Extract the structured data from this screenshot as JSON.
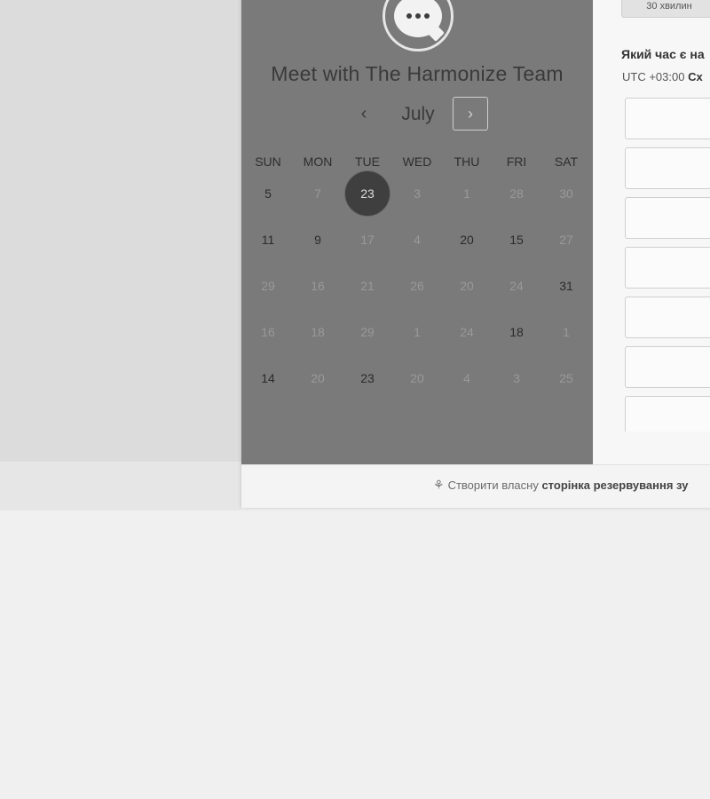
{
  "meeting": {
    "title": "Meet with The Harmonize Team",
    "avatar_icon": "chat-bubble-icon"
  },
  "calendar": {
    "month": "July",
    "prev_icon": "‹",
    "next_icon": "›",
    "weekdays": [
      "SUN",
      "MON",
      "TUE",
      "WED",
      "THU",
      "FRI",
      "SAT"
    ],
    "weeks": [
      [
        {
          "d": "5",
          "a": true
        },
        {
          "d": "7",
          "a": false
        },
        {
          "d": "23",
          "a": true,
          "s": true
        },
        {
          "d": "3",
          "a": false
        },
        {
          "d": "1",
          "a": false
        },
        {
          "d": "28",
          "a": false
        },
        {
          "d": "30",
          "a": false
        }
      ],
      [
        {
          "d": "11",
          "a": true
        },
        {
          "d": "9",
          "a": true
        },
        {
          "d": "17",
          "a": false
        },
        {
          "d": "4",
          "a": false
        },
        {
          "d": "20",
          "a": true
        },
        {
          "d": "15",
          "a": true
        },
        {
          "d": "27",
          "a": false
        }
      ],
      [
        {
          "d": "29",
          "a": false
        },
        {
          "d": "16",
          "a": false
        },
        {
          "d": "21",
          "a": false
        },
        {
          "d": "26",
          "a": false
        },
        {
          "d": "20",
          "a": false
        },
        {
          "d": "24",
          "a": false
        },
        {
          "d": "31",
          "a": true
        }
      ],
      [
        {
          "d": "16",
          "a": false
        },
        {
          "d": "18",
          "a": false
        },
        {
          "d": "29",
          "a": false
        },
        {
          "d": "1",
          "a": false
        },
        {
          "d": "24",
          "a": false
        },
        {
          "d": "18",
          "a": true
        },
        {
          "d": "1",
          "a": false
        }
      ],
      [
        {
          "d": "14",
          "a": true
        },
        {
          "d": "20",
          "a": false
        },
        {
          "d": "23",
          "a": true
        },
        {
          "d": "20",
          "a": false
        },
        {
          "d": "4",
          "a": false
        },
        {
          "d": "3",
          "a": false
        },
        {
          "d": "25",
          "a": false
        }
      ]
    ]
  },
  "right": {
    "duration_label": "30 хвилин",
    "question": "Який час є на",
    "timezone_prefix": "UTC +03:00",
    "timezone_name": "Сх",
    "slot_count": 7
  },
  "footer": {
    "text": "Створити власну",
    "link": "сторінка резервування зу",
    "icon": "sprocket-icon"
  }
}
